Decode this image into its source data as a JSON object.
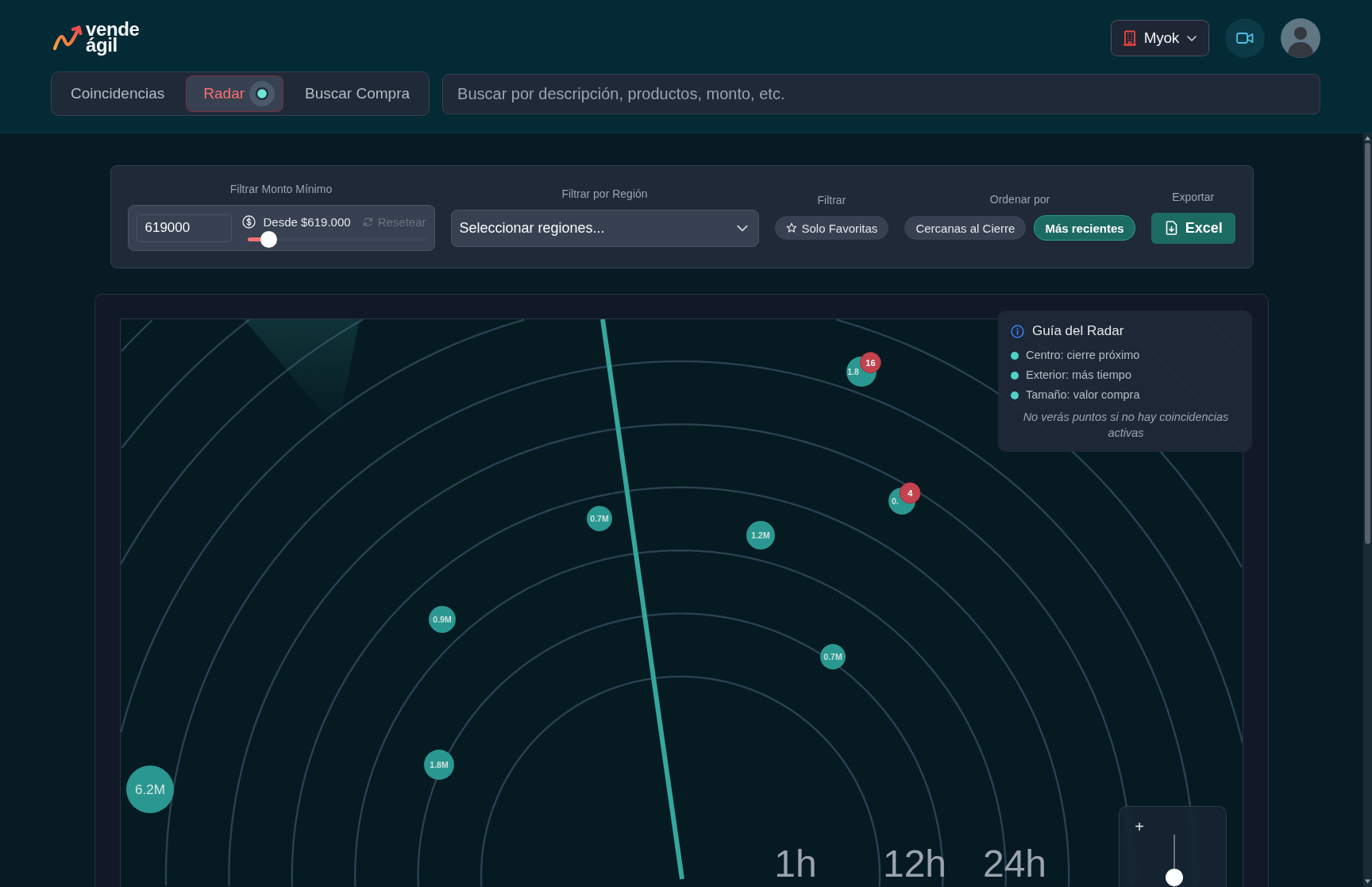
{
  "header": {
    "logo": {
      "lines": [
        "vende",
        "ágil"
      ]
    },
    "account": {
      "label": "Myok"
    }
  },
  "tabs": [
    {
      "label": "Coincidencias",
      "selected": false,
      "live": false
    },
    {
      "label": "Radar",
      "selected": true,
      "live": true
    },
    {
      "label": "Buscar Compra",
      "selected": false,
      "live": false
    }
  ],
  "search": {
    "placeholder": "Buscar por descripción, productos, monto, etc."
  },
  "filters": {
    "min_amount": {
      "label": "Filtrar Monto Mínimo",
      "value": "619000",
      "summary": "Desde $619.000",
      "reset": {
        "label": "Resetear",
        "disabled": true
      },
      "level": 0.12
    },
    "region": {
      "label": "Filtrar por Región",
      "placeholder": "Seleccionar regiones..."
    },
    "filter": {
      "label": "Filtrar",
      "chips": [
        {
          "label": "Solo Favoritas",
          "selected": false
        }
      ]
    },
    "sort": {
      "label": "Ordenar por",
      "options": [
        {
          "label": "Cercanas al Cierre",
          "selected": false
        },
        {
          "label": "Más recientes",
          "selected": true
        }
      ]
    },
    "export": {
      "label": "Exportar",
      "button": "Excel"
    }
  },
  "radar": {
    "dots": [
      {
        "label": "1.8",
        "badge": "16"
      },
      {
        "label": "0.",
        "badge": "4"
      },
      {
        "label": "0.7M"
      },
      {
        "label": "1.2M"
      },
      {
        "label": "0.9M"
      },
      {
        "label": "0.7M"
      },
      {
        "label": "1.8M"
      },
      {
        "label": "6.2M"
      }
    ],
    "ring_labels": [
      "1h",
      "12h",
      "24h"
    ],
    "guide": {
      "title": "Guía del Radar",
      "items": [
        "Centro: cierre próximo",
        "Exterior: más tiempo",
        "Tamaño: valor compra"
      ],
      "note": "No verás puntos si no hay coincidencias activas"
    },
    "zoom": {
      "zoom_in": "+",
      "level": 0.18
    }
  }
}
